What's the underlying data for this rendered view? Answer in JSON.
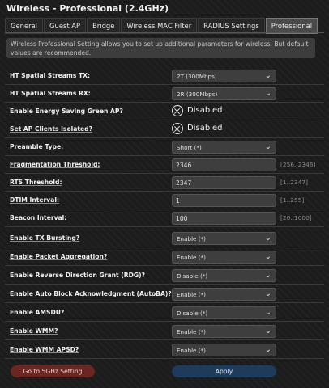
{
  "title": "Wireless - Professional (2.4GHz)",
  "tabs": [
    "General",
    "Guest AP",
    "Bridge",
    "Wireless MAC Filter",
    "RADIUS Settings",
    "Professional"
  ],
  "active_tab": "Professional",
  "info_text": "Wireless Professional Setting allows you to set up additional parameters for wireless. But default values are recommended.",
  "settings": {
    "ht_tx": {
      "label": "HT Spatial Streams TX:",
      "value": "2T (300Mbps)"
    },
    "ht_rx": {
      "label": "HT Spatial Streams RX:",
      "value": "2R (300Mbps)"
    },
    "green_ap": {
      "label": "Enable Energy Saving Green AP?",
      "value": "Disabled"
    },
    "ap_isolated": {
      "label": "Set AP Clients Isolated?",
      "value": "Disabled"
    },
    "preamble": {
      "label": "Preamble Type:",
      "value": "Short (*)"
    },
    "frag": {
      "label": "Fragmentation Threshold:",
      "value": "2346",
      "hint": "[256..2346]"
    },
    "rts": {
      "label": "RTS Threshold:",
      "value": "2347",
      "hint": "[1..2347]"
    },
    "dtim": {
      "label": "DTIM Interval:",
      "value": "1",
      "hint": "[1..255]"
    },
    "beacon": {
      "label": "Beacon Interval:",
      "value": "100",
      "hint": "[20..1000]"
    },
    "tx_burst": {
      "label": "Enable TX Bursting?",
      "value": "Enable (*)"
    },
    "pkt_agg": {
      "label": "Enable Packet Aggregation?",
      "value": "Enable (*)"
    },
    "rdg": {
      "label": "Enable Reverse Direction Grant (RDG)?",
      "value": "Disable (*)"
    },
    "autoba": {
      "label": "Enable Auto Block Acknowledgment (AutoBA)?",
      "value": "Enable (*)"
    },
    "amsdu": {
      "label": "Enable AMSDU?",
      "value": "Disable (*)"
    },
    "wmm": {
      "label": "Enable WMM?",
      "value": "Enable (*)"
    },
    "wmm_apsd": {
      "label": "Enable WMM APSD?",
      "value": "Enable (*)"
    }
  },
  "buttons": {
    "go_5ghz": "Go to 5GHz Setting",
    "apply": "Apply"
  },
  "colors": {
    "background": "#1c1c1c",
    "go_5ghz_button": "#6a2620",
    "apply_button": "#1e3b5c"
  }
}
